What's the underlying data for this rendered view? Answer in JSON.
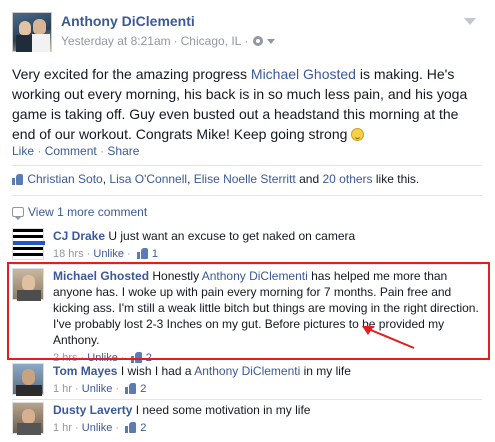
{
  "post": {
    "author": "Anthony DiClementi",
    "timestamp": "Yesterday at 8:21am",
    "location": "Chicago, IL",
    "text_before_mention": "Very excited for the amazing progress ",
    "mention": "Michael Ghosted",
    "text_after_mention": " is making. He's working out every morning, his back is in so much less pain, and his yoga game is taking off. Guy even busted out a headstand this morning at the end of our workout. Congrats Mike! Keep going strong "
  },
  "actions": {
    "like": "Like",
    "comment": "Comment",
    "share": "Share",
    "separator": "·"
  },
  "likes": {
    "names": [
      "Christian Soto",
      "Lisa O'Connell",
      "Elise Noelle Sterritt"
    ],
    "and": "and",
    "others": "20 others",
    "suffix": "like this."
  },
  "view_more": "View 1 more comment",
  "comments": [
    {
      "author": "CJ Drake",
      "text": "U just want an excuse to get naked on camera",
      "time": "18 hrs",
      "unlike": "Unlike",
      "like_count": "1"
    },
    {
      "author": "Michael Ghosted",
      "text_before_mention": "Honestly ",
      "mention": "Anthony DiClementi",
      "text_after_mention": " has helped me more than anyone has. I woke up with pain every morning for 7 months. Pain free and kicking ass. I'm still a weak little bitch but things are moving in the right direction. I've probably lost 2-3 Inches on my gut. Before pictures to be provided my Anthony.",
      "time": "2 hrs",
      "unlike": "Unlike",
      "like_count": "2"
    },
    {
      "author": "Tom Mayes",
      "text_before_mention": "I wish I had a ",
      "mention": "Anthony DiClementi",
      "text_after_mention": " in my life",
      "time": "1 hr",
      "unlike": "Unlike",
      "like_count": "2"
    },
    {
      "author": "Dusty Laverty",
      "text": "I need some motivation in my life",
      "time": "1 hr",
      "unlike": "Unlike",
      "like_count": "2"
    }
  ],
  "colors": {
    "link": "#3b5998",
    "meta": "#9197a3",
    "highlight": "#e02020"
  }
}
